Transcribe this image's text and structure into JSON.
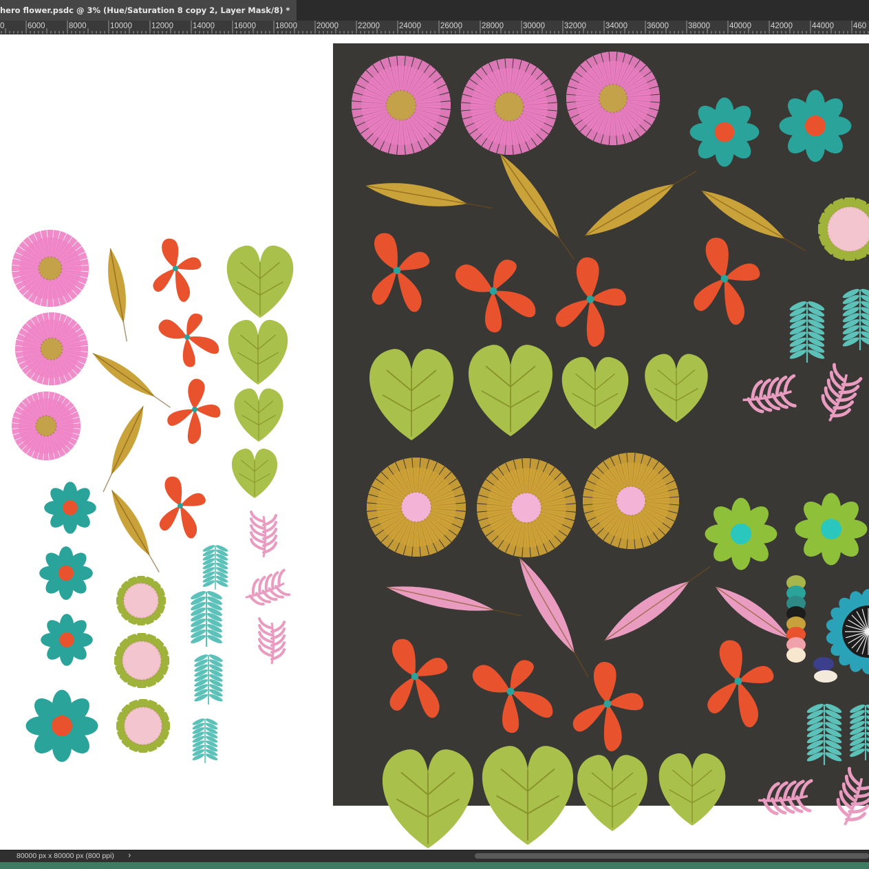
{
  "document_tab": {
    "title": "hero flower.psdc @ 3% (Hue/Saturation 8 copy 2, Layer Mask/8) *"
  },
  "ruler": {
    "labels": [
      "0",
      "6000",
      "8000",
      "10000",
      "12000",
      "14000",
      "16000",
      "18000",
      "20000",
      "22000",
      "24000",
      "26000",
      "28000",
      "30000",
      "32000",
      "34000",
      "36000",
      "38000",
      "40000",
      "42000",
      "44000",
      "460"
    ]
  },
  "status": {
    "doc_size": "80000 px x 80000 px (800 ppi)",
    "arrow": "›"
  },
  "colors": {
    "artboard": "#393834",
    "pink": "#ee7fc4",
    "teal": "#2aa39a",
    "orange": "#e8532d",
    "leaf_green": "#a9c04a",
    "ochre": "#c9a23a",
    "light_pink": "#e99cc0",
    "mint": "#5cc2b9"
  }
}
